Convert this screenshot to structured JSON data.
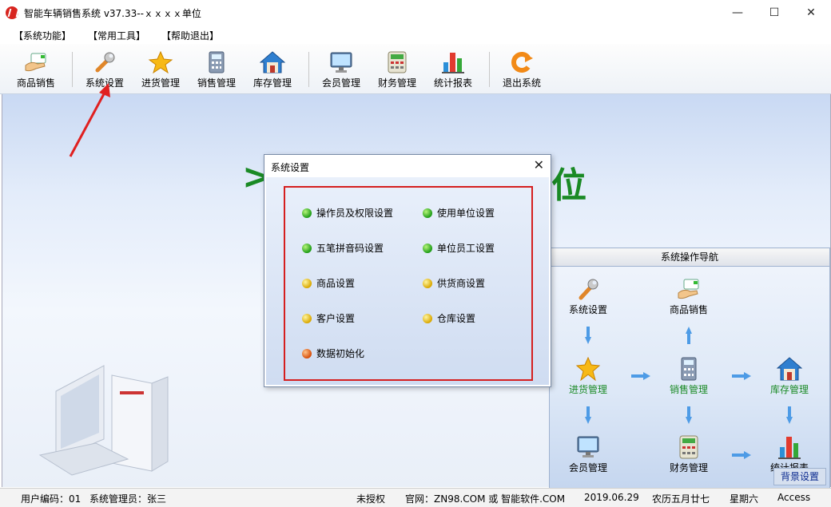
{
  "window": {
    "title": "智能车辆销售系统 v37.33--ｘｘｘｘ单位",
    "minimize": "—",
    "maximize": "☐",
    "close": "✕"
  },
  "menu": [
    "【系统功能】",
    "【常用工具】",
    "【帮助退出】"
  ],
  "toolbar": [
    {
      "label": "商品销售",
      "icon": "hand-card-icon"
    },
    {
      "label": "系统设置",
      "icon": "wrench-icon"
    },
    {
      "label": "进货管理",
      "icon": "star-icon"
    },
    {
      "label": "销售管理",
      "icon": "calculator-icon"
    },
    {
      "label": "库存管理",
      "icon": "house-icon"
    },
    {
      "label": "会员管理",
      "icon": "monitor-icon"
    },
    {
      "label": "财务管理",
      "icon": "cash-register-icon"
    },
    {
      "label": "统计报表",
      "icon": "bar-chart-icon"
    },
    {
      "label": "退出系统",
      "icon": "exit-icon"
    }
  ],
  "main": {
    "big_title_left": ">",
    "big_title_right": "位"
  },
  "nav": {
    "header": "系统操作导航",
    "items": {
      "settings": "系统设置",
      "sales_goods": "商品销售",
      "purchase": "进货管理",
      "sales_mgmt": "销售管理",
      "inventory": "库存管理",
      "member": "会员管理",
      "finance": "财务管理",
      "report": "统计报表"
    },
    "bg_button": "背景设置"
  },
  "dialog": {
    "title": "系统设置",
    "close": "✕",
    "options": {
      "op1": "操作员及权限设置",
      "op2": "使用单位设置",
      "op3": "五笔拼音码设置",
      "op4": "单位员工设置",
      "op5": "商品设置",
      "op6": "供货商设置",
      "op7": "客户设置",
      "op8": "仓库设置",
      "op9": "数据初始化"
    }
  },
  "status": {
    "user_code": "用户编码：01",
    "admin": "系统管理员：张三",
    "license": "未授权",
    "website": "官网：ZN98.COM 或 智能软件.COM",
    "date": "2019.06.29",
    "lunar": "农历五月廿七",
    "weekday": "星期六",
    "db": "Access"
  },
  "colors": {
    "accent_green": "#1a8a25",
    "highlight_red": "#d51f1f"
  }
}
